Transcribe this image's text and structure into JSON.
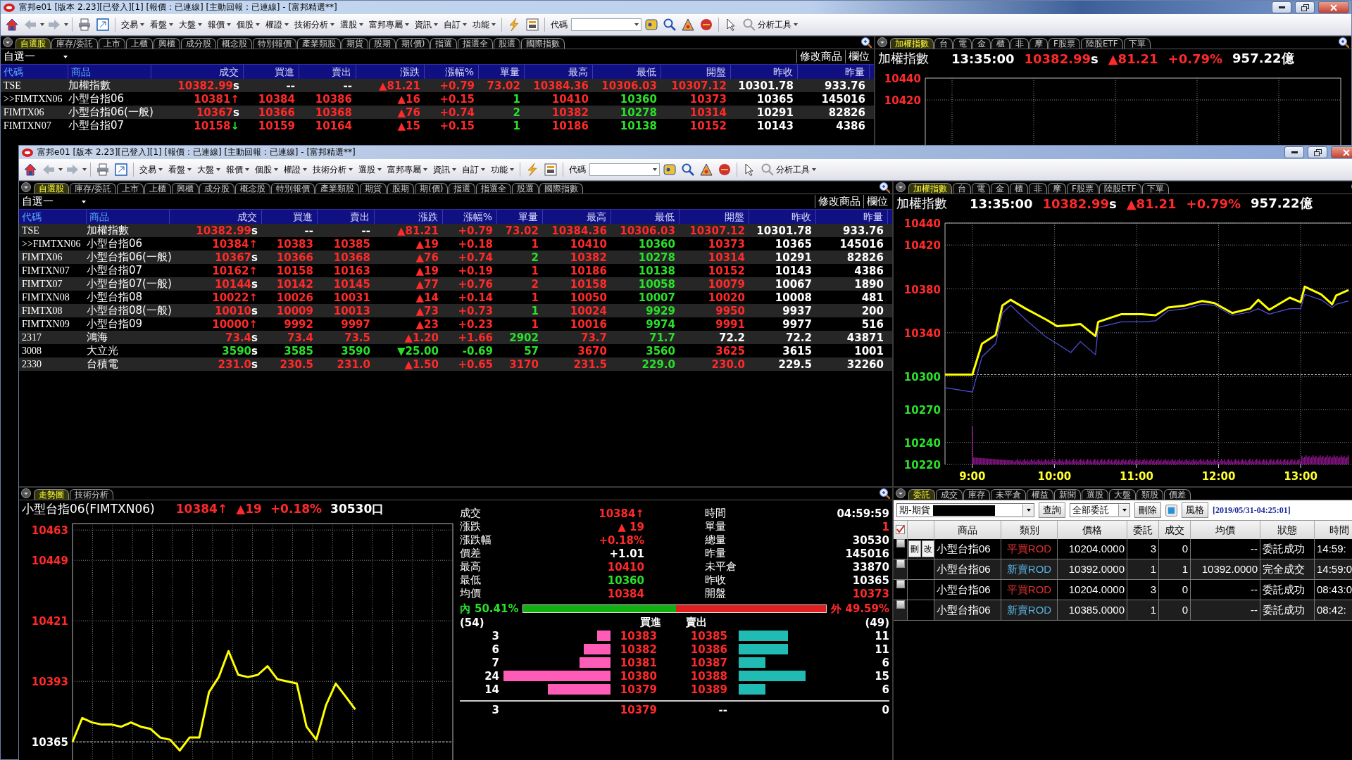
{
  "back_window": {
    "title": "富邦e01 [版本 2.23][已登入][1] [報價 : 已連線] [主動回報 : 已連線] - [富邦精選**]",
    "toolbar": {
      "menus": [
        "交易",
        "看盤",
        "大盤",
        "報價",
        "個股",
        "權證",
        "技術分析",
        "選股",
        "富邦專屬",
        "資訊",
        "自訂",
        "功能"
      ],
      "code_label": "代碼",
      "analysis_menu": "分析工具"
    },
    "watchlist": {
      "tabs": [
        {
          "label": "自選股",
          "selected": true
        },
        {
          "label": "庫存/委託",
          "selected": false
        },
        {
          "label": "上市",
          "selected": false
        },
        {
          "label": "上櫃",
          "selected": false
        },
        {
          "label": "興櫃",
          "selected": false
        },
        {
          "label": "成分股",
          "selected": false
        },
        {
          "label": "概念股",
          "selected": false
        },
        {
          "label": "特別報價",
          "selected": false
        },
        {
          "label": "產業類股",
          "selected": false
        },
        {
          "label": "期貨",
          "selected": false
        },
        {
          "label": "股期",
          "selected": false
        },
        {
          "label": "期(價)",
          "selected": false
        },
        {
          "label": "指選",
          "selected": false
        },
        {
          "label": "指選全",
          "selected": false
        },
        {
          "label": "股選",
          "selected": false
        },
        {
          "label": "國際指數",
          "selected": false
        }
      ],
      "list_name": "自選一",
      "actions": [
        "修改商品",
        "欄位"
      ],
      "columns": [
        "代碼",
        "商品",
        "成交",
        "買進",
        "賣出",
        "漲跌",
        "漲幅%",
        "單量",
        "最高",
        "最低",
        "開盤",
        "昨收",
        "昨量"
      ],
      "rows": [
        {
          "cells": [
            {
              "text": "TSE",
              "kind": "code"
            },
            {
              "text": "加權指數",
              "kind": "name"
            },
            {
              "text": "10382.99",
              "kind": "up",
              "suffix": {
                "text": "s",
                "kind": "flat"
              }
            },
            {
              "text": "--",
              "kind": "flat"
            },
            {
              "text": "--",
              "kind": "flat"
            },
            {
              "text": "▲81.21",
              "kind": "up"
            },
            {
              "text": "+0.79",
              "kind": "up"
            },
            {
              "text": "73.02",
              "kind": "up"
            },
            {
              "text": "10384.36",
              "kind": "up"
            },
            {
              "text": "10306.03",
              "kind": "up"
            },
            {
              "text": "10307.12",
              "kind": "up"
            },
            {
              "text": "10301.78",
              "kind": "flat"
            },
            {
              "text": "933.76",
              "kind": "flat"
            }
          ]
        },
        {
          "cells": [
            {
              "text": ">>FIMTXN06",
              "kind": "code"
            },
            {
              "text": "小型台指06",
              "kind": "name"
            },
            {
              "text": "10381",
              "kind": "up",
              "suffix": {
                "text": "↑",
                "kind": "up"
              }
            },
            {
              "text": "10384",
              "kind": "up"
            },
            {
              "text": "10386",
              "kind": "up"
            },
            {
              "text": "▲16",
              "kind": "up"
            },
            {
              "text": "+0.15",
              "kind": "up"
            },
            {
              "text": "1",
              "kind": "down"
            },
            {
              "text": "10410",
              "kind": "up"
            },
            {
              "text": "10360",
              "kind": "down"
            },
            {
              "text": "10373",
              "kind": "up"
            },
            {
              "text": "10365",
              "kind": "flat"
            },
            {
              "text": "145016",
              "kind": "flat"
            }
          ]
        },
        {
          "cells": [
            {
              "text": "FIMTX06",
              "kind": "code"
            },
            {
              "text": "小型台指06(一般)",
              "kind": "name"
            },
            {
              "text": "10367",
              "kind": "up",
              "suffix": {
                "text": "s",
                "kind": "flat"
              }
            },
            {
              "text": "10366",
              "kind": "up"
            },
            {
              "text": "10368",
              "kind": "up"
            },
            {
              "text": "▲76",
              "kind": "up"
            },
            {
              "text": "+0.74",
              "kind": "up"
            },
            {
              "text": "2",
              "kind": "down"
            },
            {
              "text": "10382",
              "kind": "up"
            },
            {
              "text": "10278",
              "kind": "down"
            },
            {
              "text": "10314",
              "kind": "up"
            },
            {
              "text": "10291",
              "kind": "flat"
            },
            {
              "text": "82826",
              "kind": "flat"
            }
          ]
        },
        {
          "cells": [
            {
              "text": "FIMTXN07",
              "kind": "code"
            },
            {
              "text": "小型台指07",
              "kind": "name"
            },
            {
              "text": "10158",
              "kind": "up",
              "suffix": {
                "text": "↓",
                "kind": "down"
              }
            },
            {
              "text": "10159",
              "kind": "up"
            },
            {
              "text": "10164",
              "kind": "up"
            },
            {
              "text": "▲15",
              "kind": "up"
            },
            {
              "text": "+0.15",
              "kind": "up"
            },
            {
              "text": "1",
              "kind": "down"
            },
            {
              "text": "10186",
              "kind": "up"
            },
            {
              "text": "10138",
              "kind": "down"
            },
            {
              "text": "10152",
              "kind": "up"
            },
            {
              "text": "10143",
              "kind": "flat"
            },
            {
              "text": "4386",
              "kind": "flat"
            }
          ]
        }
      ]
    },
    "index_panel": {
      "tabs": [
        {
          "label": "加權指數",
          "selected": true
        },
        {
          "label": "台",
          "selected": false
        },
        {
          "label": "電",
          "selected": false
        },
        {
          "label": "金",
          "selected": false
        },
        {
          "label": "櫃",
          "selected": false
        },
        {
          "label": "非",
          "selected": false
        },
        {
          "label": "摩",
          "selected": false
        },
        {
          "label": "F股票",
          "selected": false
        },
        {
          "label": "陸股ETF",
          "selected": false
        },
        {
          "label": "下單",
          "selected": false
        }
      ],
      "name": "加權指數",
      "time": "13:35:00",
      "price": "10382.99",
      "price_suffix": "s",
      "change": "▲81.21",
      "change_pct": "+0.79%",
      "turnover": "957.22億",
      "axis_labels": [
        "10440",
        "10420"
      ]
    }
  },
  "front_window": {
    "title": "富邦e01 [版本 2.23][已登入][1] [報價 : 已連線] [主動回報 : 已連線] - [富邦精選**]",
    "toolbar": {
      "menus": [
        "交易",
        "看盤",
        "大盤",
        "報價",
        "個股",
        "權證",
        "技術分析",
        "選股",
        "富邦專屬",
        "資訊",
        "自訂",
        "功能"
      ],
      "code_label": "代碼",
      "analysis_menu": "分析工具"
    },
    "watchlist": {
      "tabs": [
        {
          "label": "自選股",
          "selected": true
        },
        {
          "label": "庫存/委託",
          "selected": false
        },
        {
          "label": "上市",
          "selected": false
        },
        {
          "label": "上櫃",
          "selected": false
        },
        {
          "label": "興櫃",
          "selected": false
        },
        {
          "label": "成分股",
          "selected": false
        },
        {
          "label": "概念股",
          "selected": false
        },
        {
          "label": "特別報價",
          "selected": false
        },
        {
          "label": "產業類股",
          "selected": false
        },
        {
          "label": "期貨",
          "selected": false
        },
        {
          "label": "股期",
          "selected": false
        },
        {
          "label": "期(價)",
          "selected": false
        },
        {
          "label": "指選",
          "selected": false
        },
        {
          "label": "指選全",
          "selected": false
        },
        {
          "label": "股選",
          "selected": false
        },
        {
          "label": "國際指數",
          "selected": false
        }
      ],
      "list_name": "自選一",
      "actions": [
        "修改商品",
        "欄位"
      ],
      "columns": [
        "代碼",
        "商品",
        "成交",
        "買進",
        "賣出",
        "漲跌",
        "漲幅%",
        "單量",
        "最高",
        "最低",
        "開盤",
        "昨收",
        "昨量"
      ],
      "rows": [
        {
          "cells": [
            {
              "text": "TSE",
              "kind": "code"
            },
            {
              "text": "加權指數",
              "kind": "name"
            },
            {
              "text": "10382.99",
              "kind": "up",
              "suffix": {
                "text": "s",
                "kind": "flat"
              }
            },
            {
              "text": "--",
              "kind": "flat"
            },
            {
              "text": "--",
              "kind": "flat"
            },
            {
              "text": "▲81.21",
              "kind": "up"
            },
            {
              "text": "+0.79",
              "kind": "up"
            },
            {
              "text": "73.02",
              "kind": "up"
            },
            {
              "text": "10384.36",
              "kind": "up"
            },
            {
              "text": "10306.03",
              "kind": "up"
            },
            {
              "text": "10307.12",
              "kind": "up"
            },
            {
              "text": "10301.78",
              "kind": "flat"
            },
            {
              "text": "933.76",
              "kind": "flat"
            }
          ]
        },
        {
          "cells": [
            {
              "text": ">>FIMTXN06",
              "kind": "code"
            },
            {
              "text": "小型台指06",
              "kind": "name"
            },
            {
              "text": "10384",
              "kind": "up",
              "suffix": {
                "text": "↑",
                "kind": "up"
              }
            },
            {
              "text": "10383",
              "kind": "up"
            },
            {
              "text": "10385",
              "kind": "up"
            },
            {
              "text": "▲19",
              "kind": "up"
            },
            {
              "text": "+0.18",
              "kind": "up"
            },
            {
              "text": "1",
              "kind": "up"
            },
            {
              "text": "10410",
              "kind": "up"
            },
            {
              "text": "10360",
              "kind": "down"
            },
            {
              "text": "10373",
              "kind": "up"
            },
            {
              "text": "10365",
              "kind": "flat"
            },
            {
              "text": "145016",
              "kind": "flat"
            }
          ]
        },
        {
          "cells": [
            {
              "text": "FIMTX06",
              "kind": "code"
            },
            {
              "text": "小型台指06(一般)",
              "kind": "name"
            },
            {
              "text": "10367",
              "kind": "up",
              "suffix": {
                "text": "s",
                "kind": "flat"
              }
            },
            {
              "text": "10366",
              "kind": "up"
            },
            {
              "text": "10368",
              "kind": "up"
            },
            {
              "text": "▲76",
              "kind": "up"
            },
            {
              "text": "+0.74",
              "kind": "up"
            },
            {
              "text": "2",
              "kind": "down"
            },
            {
              "text": "10382",
              "kind": "up"
            },
            {
              "text": "10278",
              "kind": "down"
            },
            {
              "text": "10314",
              "kind": "up"
            },
            {
              "text": "10291",
              "kind": "flat"
            },
            {
              "text": "82826",
              "kind": "flat"
            }
          ]
        },
        {
          "cells": [
            {
              "text": "FIMTXN07",
              "kind": "code"
            },
            {
              "text": "小型台指07",
              "kind": "name"
            },
            {
              "text": "10162",
              "kind": "up",
              "suffix": {
                "text": "↑",
                "kind": "up"
              }
            },
            {
              "text": "10158",
              "kind": "up"
            },
            {
              "text": "10163",
              "kind": "up"
            },
            {
              "text": "▲19",
              "kind": "up"
            },
            {
              "text": "+0.19",
              "kind": "up"
            },
            {
              "text": "1",
              "kind": "up"
            },
            {
              "text": "10186",
              "kind": "up"
            },
            {
              "text": "10138",
              "kind": "down"
            },
            {
              "text": "10152",
              "kind": "up"
            },
            {
              "text": "10143",
              "kind": "flat"
            },
            {
              "text": "4386",
              "kind": "flat"
            }
          ]
        },
        {
          "cells": [
            {
              "text": "FIMTX07",
              "kind": "code"
            },
            {
              "text": "小型台指07(一般)",
              "kind": "name"
            },
            {
              "text": "10144",
              "kind": "up",
              "suffix": {
                "text": "s",
                "kind": "flat"
              }
            },
            {
              "text": "10142",
              "kind": "up"
            },
            {
              "text": "10145",
              "kind": "up"
            },
            {
              "text": "▲77",
              "kind": "up"
            },
            {
              "text": "+0.76",
              "kind": "up"
            },
            {
              "text": "2",
              "kind": "up"
            },
            {
              "text": "10158",
              "kind": "up"
            },
            {
              "text": "10058",
              "kind": "down"
            },
            {
              "text": "10079",
              "kind": "up"
            },
            {
              "text": "10067",
              "kind": "flat"
            },
            {
              "text": "1890",
              "kind": "flat"
            }
          ]
        },
        {
          "cells": [
            {
              "text": "FIMTXN08",
              "kind": "code"
            },
            {
              "text": "小型台指08",
              "kind": "name"
            },
            {
              "text": "10022",
              "kind": "up",
              "suffix": {
                "text": "↑",
                "kind": "up"
              }
            },
            {
              "text": "10026",
              "kind": "up"
            },
            {
              "text": "10031",
              "kind": "up"
            },
            {
              "text": "▲14",
              "kind": "up"
            },
            {
              "text": "+0.14",
              "kind": "up"
            },
            {
              "text": "1",
              "kind": "up"
            },
            {
              "text": "10050",
              "kind": "up"
            },
            {
              "text": "10007",
              "kind": "down"
            },
            {
              "text": "10020",
              "kind": "up"
            },
            {
              "text": "10008",
              "kind": "flat"
            },
            {
              "text": "481",
              "kind": "flat"
            }
          ]
        },
        {
          "cells": [
            {
              "text": "FIMTX08",
              "kind": "code"
            },
            {
              "text": "小型台指08(一般)",
              "kind": "name"
            },
            {
              "text": "10010",
              "kind": "up",
              "suffix": {
                "text": "s",
                "kind": "flat"
              }
            },
            {
              "text": "10009",
              "kind": "up"
            },
            {
              "text": "10013",
              "kind": "up"
            },
            {
              "text": "▲73",
              "kind": "up"
            },
            {
              "text": "+0.73",
              "kind": "up"
            },
            {
              "text": "1",
              "kind": "down"
            },
            {
              "text": "10024",
              "kind": "up"
            },
            {
              "text": "9929",
              "kind": "down"
            },
            {
              "text": "9950",
              "kind": "up"
            },
            {
              "text": "9937",
              "kind": "flat"
            },
            {
              "text": "200",
              "kind": "flat"
            }
          ]
        },
        {
          "cells": [
            {
              "text": "FIMTXN09",
              "kind": "code"
            },
            {
              "text": "小型台指09",
              "kind": "name"
            },
            {
              "text": "10000",
              "kind": "up",
              "suffix": {
                "text": "↑",
                "kind": "up"
              }
            },
            {
              "text": "9992",
              "kind": "up"
            },
            {
              "text": "9997",
              "kind": "up"
            },
            {
              "text": "▲23",
              "kind": "up"
            },
            {
              "text": "+0.23",
              "kind": "up"
            },
            {
              "text": "1",
              "kind": "up"
            },
            {
              "text": "10016",
              "kind": "up"
            },
            {
              "text": "9974",
              "kind": "down"
            },
            {
              "text": "9991",
              "kind": "up"
            },
            {
              "text": "9977",
              "kind": "flat"
            },
            {
              "text": "516",
              "kind": "flat"
            }
          ]
        },
        {
          "cells": [
            {
              "text": "2317",
              "kind": "code"
            },
            {
              "text": "鴻海",
              "kind": "name"
            },
            {
              "text": "73.4",
              "kind": "up",
              "suffix": {
                "text": "s",
                "kind": "flat"
              }
            },
            {
              "text": "73.4",
              "kind": "up"
            },
            {
              "text": "73.5",
              "kind": "up"
            },
            {
              "text": "▲1.20",
              "kind": "up"
            },
            {
              "text": "+1.66",
              "kind": "up"
            },
            {
              "text": "2902",
              "kind": "down"
            },
            {
              "text": "73.7",
              "kind": "up"
            },
            {
              "text": "71.7",
              "kind": "down"
            },
            {
              "text": "72.2",
              "kind": "flat"
            },
            {
              "text": "72.2",
              "kind": "flat"
            },
            {
              "text": "43871",
              "kind": "flat"
            }
          ]
        },
        {
          "cells": [
            {
              "text": "3008",
              "kind": "code"
            },
            {
              "text": "大立光",
              "kind": "name"
            },
            {
              "text": "3590",
              "kind": "down",
              "suffix": {
                "text": "s",
                "kind": "flat"
              }
            },
            {
              "text": "3585",
              "kind": "down"
            },
            {
              "text": "3590",
              "kind": "down"
            },
            {
              "text": "▼25.00",
              "kind": "down"
            },
            {
              "text": "-0.69",
              "kind": "down"
            },
            {
              "text": "57",
              "kind": "down"
            },
            {
              "text": "3670",
              "kind": "up"
            },
            {
              "text": "3560",
              "kind": "down"
            },
            {
              "text": "3625",
              "kind": "up"
            },
            {
              "text": "3615",
              "kind": "flat"
            },
            {
              "text": "1001",
              "kind": "flat"
            }
          ]
        },
        {
          "cells": [
            {
              "text": "2330",
              "kind": "code"
            },
            {
              "text": "台積電",
              "kind": "name"
            },
            {
              "text": "231.0",
              "kind": "up",
              "suffix": {
                "text": "s",
                "kind": "flat"
              }
            },
            {
              "text": "230.5",
              "kind": "up"
            },
            {
              "text": "231.0",
              "kind": "up"
            },
            {
              "text": "▲1.50",
              "kind": "up"
            },
            {
              "text": "+0.65",
              "kind": "up"
            },
            {
              "text": "3170",
              "kind": "up"
            },
            {
              "text": "231.5",
              "kind": "up"
            },
            {
              "text": "229.0",
              "kind": "down"
            },
            {
              "text": "230.0",
              "kind": "up"
            },
            {
              "text": "229.5",
              "kind": "flat"
            },
            {
              "text": "32260",
              "kind": "flat"
            }
          ]
        }
      ]
    },
    "index_panel": {
      "tabs": [
        {
          "label": "加權指數",
          "selected": true
        },
        {
          "label": "台",
          "selected": false
        },
        {
          "label": "電",
          "selected": false
        },
        {
          "label": "金",
          "selected": false
        },
        {
          "label": "櫃",
          "selected": false
        },
        {
          "label": "非",
          "selected": false
        },
        {
          "label": "摩",
          "selected": false
        },
        {
          "label": "F股票",
          "selected": false
        },
        {
          "label": "陸股ETF",
          "selected": false
        },
        {
          "label": "下單",
          "selected": false
        }
      ],
      "name": "加權指數",
      "time": "13:35:00",
      "price": "10382.99",
      "price_suffix": "s",
      "change": "▲81.21",
      "change_pct": "+0.79%",
      "turnover": "957.22億",
      "chart_data": {
        "type": "line",
        "x": [
          520,
          540,
          547,
          557,
          562,
          568,
          579,
          594,
          602,
          612,
          619,
          630,
          632,
          649,
          664,
          674,
          683,
          696,
          708,
          717,
          730,
          743,
          749,
          757,
          772,
          780,
          783,
          795,
          803,
          806,
          815
        ],
        "series": [
          {
            "color": "#ffff00",
            "values": [
              10302,
              10302,
              10330,
              10338,
              10365,
              10370,
              10362,
              10352,
              10346,
              10347,
              10348,
              10337,
              10350,
              10357,
              10357,
              10356,
              10363,
              10365,
              10369,
              10367,
              10358,
              10362,
              10370,
              10361,
              10372,
              10368,
              10382,
              10375,
              10366,
              10374,
              10379
            ]
          },
          {
            "color": "#5050e0",
            "values": [
              10290,
              10286,
              10318,
              10330,
              10358,
              10365,
              10352,
              10336,
              10330,
              10322,
              10332,
              10320,
              10345,
              10350,
              10350,
              10351,
              10360,
              10362,
              10366,
              10365,
              10356,
              10359,
              10362,
              10357,
              10362,
              10362,
              10375,
              10370,
              10363,
              10366,
              10369
            ]
          }
        ],
        "xlim": [
          520,
          817
        ],
        "ylim": [
          10220,
          10440
        ],
        "xticks": [
          {
            "value": 540,
            "label": "9:00"
          },
          {
            "value": 600,
            "label": "10:00"
          },
          {
            "value": 660,
            "label": "11:00"
          },
          {
            "value": 720,
            "label": "12:00"
          },
          {
            "value": 780,
            "label": "13:00"
          }
        ],
        "yticks": [
          10440,
          10420,
          10380,
          10340,
          10300,
          10270,
          10240,
          10220
        ],
        "grid": true,
        "ref_lines": [
          {
            "axis": "y",
            "value": 10301.78
          }
        ]
      }
    },
    "trend_panel": {
      "tabs": [
        {
          "label": "走勢圖",
          "selected": true
        },
        {
          "label": "技術分析",
          "selected": false
        }
      ],
      "symbol": "小型台指06(FIMTXN06)",
      "price": "10384",
      "price_arrow": "↑",
      "change": "▲19",
      "change_pct": "+0.18%",
      "volume": "30530口",
      "chart_data": {
        "type": "line",
        "categories": [
          null,
          null,
          null,
          null,
          null,
          null,
          null,
          null,
          null,
          null,
          null,
          null,
          null,
          null,
          null,
          null,
          null,
          null,
          null,
          null,
          null,
          null,
          null,
          null,
          null,
          null,
          null,
          null,
          null,
          null,
          null,
          null,
          null,
          null,
          null,
          null,
          null,
          null,
          null,
          null
        ],
        "series": [
          {
            "color": "#ffff00",
            "values": [
              10365,
              10376,
              10374,
              10373,
              10373,
              10372,
              10374,
              10372,
              10371,
              10367,
              10366,
              10361,
              10367,
              10367,
              10388,
              10395,
              10407,
              10396,
              10395,
              10396,
              10400,
              10394,
              10393,
              10392,
              10372,
              10366,
              10382,
              10392,
              10386,
              10380,
              null,
              null,
              null,
              null,
              null,
              null,
              null,
              null,
              null,
              null
            ]
          }
        ],
        "ylim": [
          10354,
          10466
        ],
        "yticks": [
          10463,
          10449,
          10421,
          10393,
          10365
        ],
        "grid": true,
        "ref_lines": [
          {
            "axis": "y",
            "value": 10365
          }
        ]
      },
      "quote": {
        "left": [
          {
            "label": "成交",
            "value": "10384↑",
            "kind": "up"
          },
          {
            "label": "漲跌",
            "value": "▲ 19",
            "kind": "up"
          },
          {
            "label": "漲跌幅",
            "value": "+0.18%",
            "kind": "up"
          },
          {
            "label": "價差",
            "value": "+1.01",
            "kind": "flat"
          },
          {
            "label": "最高",
            "value": "10410",
            "kind": "up"
          },
          {
            "label": "最低",
            "value": "10360",
            "kind": "down"
          },
          {
            "label": "均價",
            "value": "10384",
            "kind": "up"
          }
        ],
        "right": [
          {
            "label": "時間",
            "value": "04:59:59",
            "kind": "flat"
          },
          {
            "label": "單量",
            "value": "1",
            "kind": "up"
          },
          {
            "label": "總量",
            "value": "30530",
            "kind": "flat"
          },
          {
            "label": "昨量",
            "value": "145016",
            "kind": "flat"
          },
          {
            "label": "未平倉",
            "value": "33870",
            "kind": "flat"
          },
          {
            "label": "昨收",
            "value": "10365",
            "kind": "flat"
          },
          {
            "label": "開盤",
            "value": "10373",
            "kind": "up"
          }
        ]
      },
      "flow": {
        "inner_label": "內",
        "inner_pct": "50.41%",
        "level": 0.5041,
        "outer_label": "外",
        "outer_pct": "49.59%"
      },
      "depth": {
        "bid_total": "(54)",
        "bid_header": "買進",
        "ask_header": "賣出",
        "ask_total": "(49)",
        "rows": [
          {
            "bid_qty": "3",
            "bid": "10383",
            "ask": "10385",
            "ask_qty": "11"
          },
          {
            "bid_qty": "6",
            "bid": "10382",
            "ask": "10386",
            "ask_qty": "11"
          },
          {
            "bid_qty": "7",
            "bid": "10381",
            "ask": "10387",
            "ask_qty": "6"
          },
          {
            "bid_qty": "24",
            "bid": "10380",
            "ask": "10388",
            "ask_qty": "15"
          },
          {
            "bid_qty": "14",
            "bid": "10379",
            "ask": "10389",
            "ask_qty": "6"
          }
        ],
        "last": {
          "qty": "3",
          "bid": "10379",
          "ask": "--",
          "ask_qty": "0"
        }
      }
    },
    "order_panel": {
      "tabs": [
        {
          "label": "委託",
          "selected": true
        },
        {
          "label": "成交",
          "selected": false
        },
        {
          "label": "庫存",
          "selected": false
        },
        {
          "label": "未平倉",
          "selected": false
        },
        {
          "label": "權益",
          "selected": false
        },
        {
          "label": "新聞",
          "selected": false
        },
        {
          "label": "選股",
          "selected": false
        },
        {
          "label": "大盤",
          "selected": false
        },
        {
          "label": "類股",
          "selected": false
        },
        {
          "label": "價差",
          "selected": false
        }
      ],
      "account_select": "期-期貨",
      "query_button": "查詢",
      "filter_select": "全部委託",
      "delete_button": "刪除",
      "style_button": "風格",
      "timestamp": "[2019/05/31-04:25:01]",
      "select_all": true,
      "columns": [
        "商品",
        "類別",
        "價格",
        "委託",
        "成交",
        "均價",
        "狀態",
        "時間"
      ],
      "rows": [
        {
          "checked": false,
          "actions": [
            "刪",
            "改"
          ],
          "product": "小型台指06",
          "type": "平買ROD",
          "kind": "buy",
          "price": "10204.0000",
          "qty": "3",
          "filled": "0",
          "avg": "--",
          "status": "委託成功",
          "time": "14:59:"
        },
        {
          "checked": false,
          "product": "小型台指06",
          "type": "新賣ROD",
          "kind": "sell",
          "price": "10392.0000",
          "qty": "1",
          "filled": "1",
          "avg": "10392.0000",
          "status": "完全成交",
          "time": "14:59:0"
        },
        {
          "checked": false,
          "product": "小型台指06",
          "type": "平買ROD",
          "kind": "buy",
          "price": "10204.0000",
          "qty": "3",
          "filled": "0",
          "avg": "--",
          "status": "委託成功",
          "time": "08:43:0"
        },
        {
          "checked": false,
          "product": "小型台指06",
          "type": "新賣ROD",
          "kind": "sell",
          "price": "10385.0000",
          "qty": "1",
          "filled": "0",
          "avg": "--",
          "status": "委託成功",
          "time": "08:42:"
        }
      ]
    }
  }
}
